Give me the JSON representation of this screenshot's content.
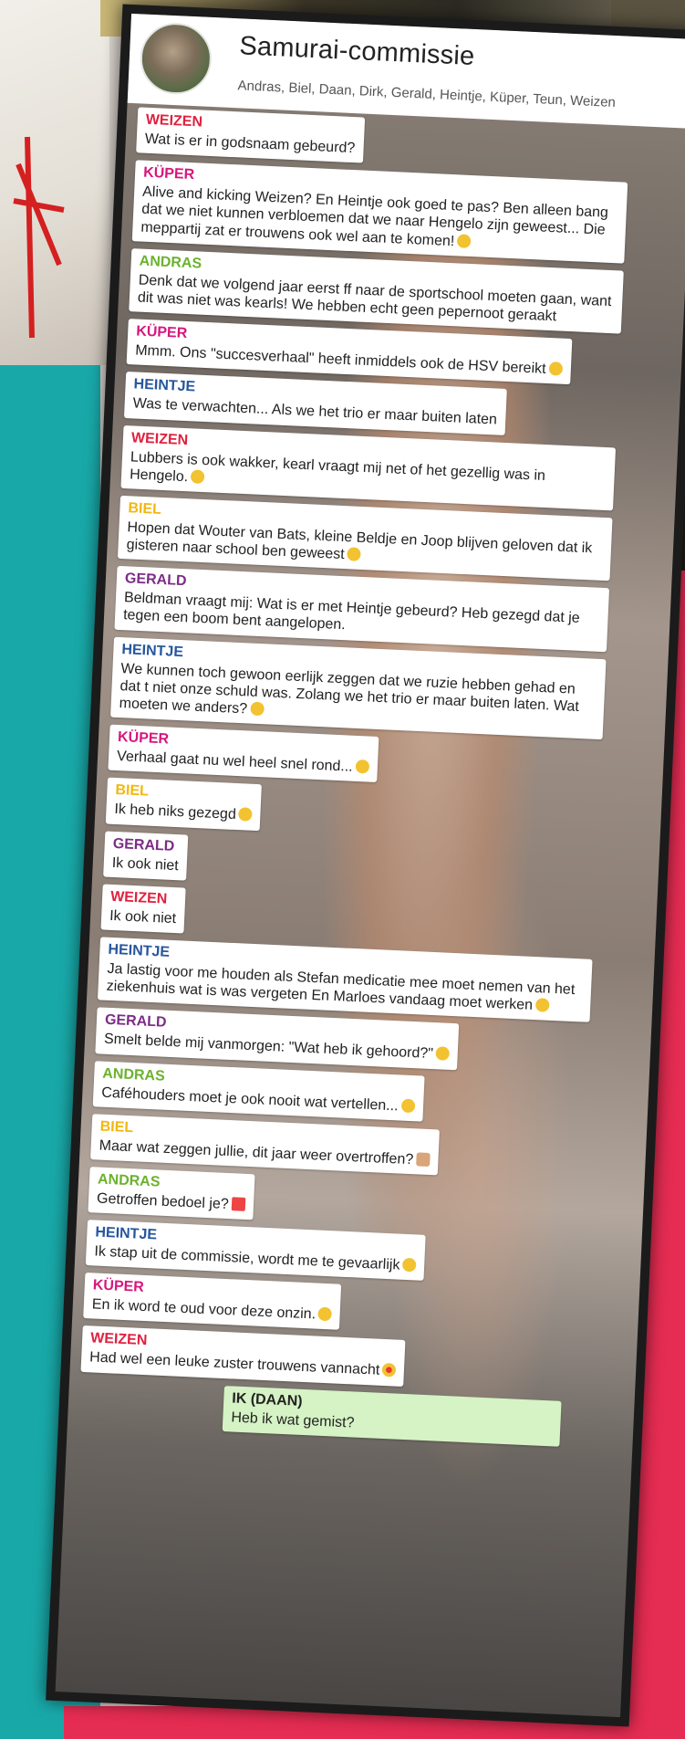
{
  "group": {
    "title": "Samurai-commissie",
    "members": "Andras, Biel, Daan, Dirk, Gerald, Heintje, Küper, Teun, Weizen"
  },
  "messages": [
    {
      "sender": "WEIZEN",
      "color": "#e0213f",
      "text": "Wat is er in godsnaam gebeurd?"
    },
    {
      "sender": "KÜPER",
      "color": "#d6177e",
      "text": "Alive and kicking Weizen? En Heintje ook goed te pas? Ben alleen bang dat we niet kunnen verbloemen dat we naar Hengelo zijn geweest... Die meppartij zat er trouwens ook wel aan te komen!",
      "emoji": "smiley"
    },
    {
      "sender": "ANDRAS",
      "color": "#6bb22d",
      "text": "Denk dat we volgend jaar eerst ff naar de sportschool moeten gaan, want dit was niet was kearls! We hebben echt geen pepernoot geraakt"
    },
    {
      "sender": "KÜPER",
      "color": "#d6177e",
      "text": "Mmm. Ons \"succesverhaal\" heeft inmiddels ook de HSV bereikt",
      "emoji": "smiley"
    },
    {
      "sender": "HEINTJE",
      "color": "#26569e",
      "text": "Was te verwachten... Als we het trio er maar buiten laten"
    },
    {
      "sender": "WEIZEN",
      "color": "#e0213f",
      "text": "Lubbers is ook wakker, kearl vraagt mij net of het gezellig was in Hengelo.",
      "emoji": "smiley"
    },
    {
      "sender": "BIEL",
      "color": "#f2b70f",
      "text": "Hopen dat Wouter van Bats, kleine Beldje en Joop blijven geloven dat ik gisteren naar school ben geweest",
      "emoji": "smiley"
    },
    {
      "sender": "GERALD",
      "color": "#7b2c86",
      "text": "Beldman vraagt mij: Wat is er met Heintje gebeurd? Heb gezegd dat je tegen een boom bent aangelopen."
    },
    {
      "sender": "HEINTJE",
      "color": "#26569e",
      "text": "We kunnen toch gewoon eerlijk zeggen dat we ruzie hebben gehad en dat t niet onze schuld was. Zolang we het trio er maar buiten laten. Wat moeten we anders?",
      "emoji": "smiley"
    },
    {
      "sender": "KÜPER",
      "color": "#d6177e",
      "text": "Verhaal gaat nu wel heel snel rond...",
      "emoji": "smiley"
    },
    {
      "sender": "BIEL",
      "color": "#f2b70f",
      "text": "Ik heb niks gezegd",
      "emoji": "smiley"
    },
    {
      "sender": "GERALD",
      "color": "#7b2c86",
      "text": "Ik ook niet"
    },
    {
      "sender": "WEIZEN",
      "color": "#e0213f",
      "text": "Ik ook niet"
    },
    {
      "sender": "HEINTJE",
      "color": "#26569e",
      "text": "Ja lastig voor me houden als Stefan medicatie mee moet nemen van het ziekenhuis wat is was vergeten En Marloes vandaag moet werken",
      "emoji": "smiley"
    },
    {
      "sender": "GERALD",
      "color": "#7b2c86",
      "text": "Smelt belde mij vanmorgen: \"Wat heb ik gehoord?\"",
      "emoji": "smiley"
    },
    {
      "sender": "ANDRAS",
      "color": "#6bb22d",
      "text": "Caféhouders moet je ook nooit wat vertellen...",
      "emoji": "smiley"
    },
    {
      "sender": "BIEL",
      "color": "#f2b70f",
      "text": "Maar wat zeggen jullie, dit jaar weer overtroffen?",
      "emoji": "thumb"
    },
    {
      "sender": "ANDRAS",
      "color": "#6bb22d",
      "text": "Getroffen bedoel je?",
      "emoji": "anger"
    },
    {
      "sender": "HEINTJE",
      "color": "#26569e",
      "text": "Ik stap uit de commissie, wordt me te gevaarlijk",
      "emoji": "smiley"
    },
    {
      "sender": "KÜPER",
      "color": "#d6177e",
      "text": "En ik word te oud voor deze onzin.",
      "emoji": "smiley"
    },
    {
      "sender": "WEIZEN",
      "color": "#e0213f",
      "text": "Had wel een leuke zuster trouwens vannacht",
      "emoji": "heart-eyes"
    },
    {
      "sender": "IK (DAAN)",
      "color": "#222222",
      "text": "Heb ik wat gemist?",
      "self": true
    }
  ]
}
